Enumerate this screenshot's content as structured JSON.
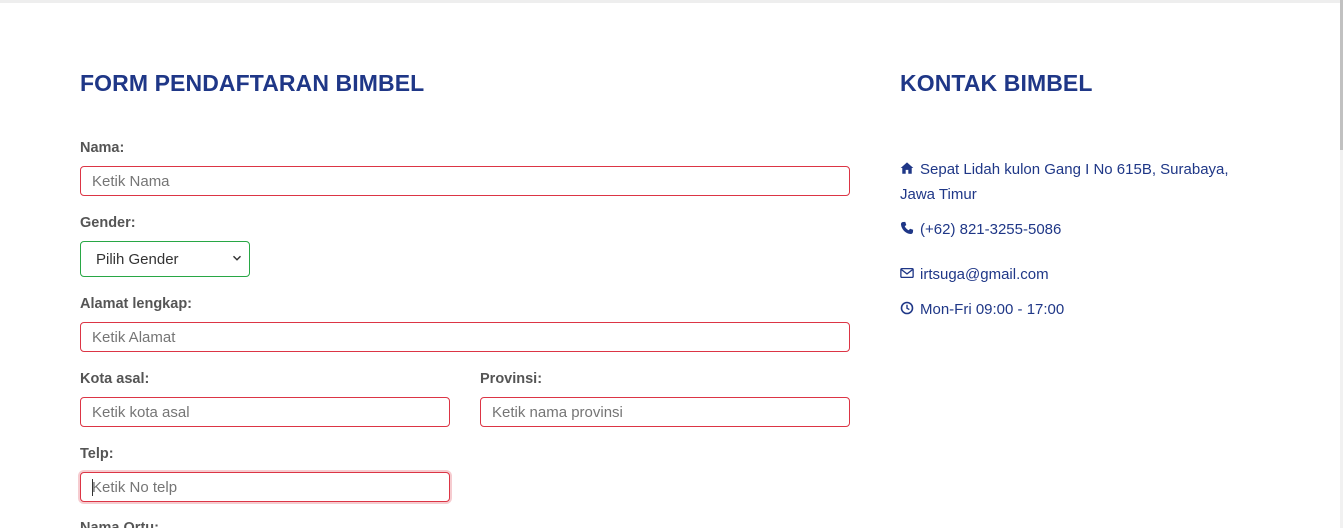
{
  "form": {
    "title": "FORM PENDAFTARAN BIMBEL",
    "nama_label": "Nama:",
    "nama_placeholder": "Ketik Nama",
    "gender_label": "Gender:",
    "gender_value": "Pilih Gender",
    "alamat_label": "Alamat lengkap:",
    "alamat_placeholder": "Ketik Alamat",
    "kota_label": "Kota asal:",
    "kota_placeholder": "Ketik kota asal",
    "provinsi_label": "Provinsi:",
    "provinsi_placeholder": "Ketik nama provinsi",
    "telp_label": "Telp:",
    "telp_placeholder": "Ketik No telp",
    "ortu_label": "Nama Ortu:"
  },
  "contact": {
    "title": "KONTAK BIMBEL",
    "address_line1": "Sepat Lidah kulon Gang I No 615B, Surabaya,",
    "address_line2": "Jawa Timur",
    "phone": "(+62) 821-3255-5086",
    "email": "irtsuga@gmail.com",
    "hours": "Mon-Fri 09:00 - 17:00",
    "icons": [
      "home-icon",
      "phone-icon",
      "envelope-icon",
      "clock-icon"
    ]
  },
  "colors": {
    "heading": "#1f3787",
    "invalid_border": "#dc3545",
    "valid_border": "#28a745"
  }
}
